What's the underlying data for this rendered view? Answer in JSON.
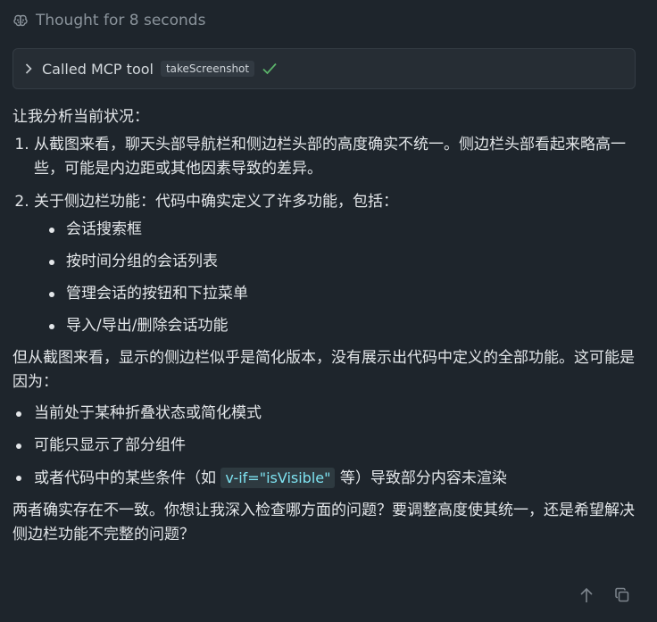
{
  "thought": {
    "label": "Thought for 8 seconds",
    "icon": "brain-icon"
  },
  "tool_call": {
    "label": "Called MCP tool",
    "tool_name": "takeScreenshot",
    "status_icon": "check-icon",
    "status_color": "#5bb36a"
  },
  "message": {
    "intro": "让我分析当前状况：",
    "point1": "从截图来看，聊天头部导航栏和侧边栏头部的高度确实不统一。侧边栏头部看起来略高一些，可能是内边距或其他因素导致的差异。",
    "point2": "关于侧边栏功能：代码中确实定义了许多功能，包括：",
    "features": [
      "会话搜索框",
      "按时间分组的会话列表",
      "管理会话的按钮和下拉菜单",
      "导入/导出/删除会话功能"
    ],
    "para2": "但从截图来看，显示的侧边栏似乎是简化版本，没有展示出代码中定义的全部功能。这可能是因为：",
    "reasons": {
      "r1": "当前处于某种折叠状态或简化模式",
      "r2": "可能只显示了部分组件",
      "r3_prefix": "或者代码中的某些条件（如 ",
      "r3_code": "v-if=\"isVisible\"",
      "r3_suffix": " 等）导致部分内容未渲染"
    },
    "closing": "两者确实存在不一致。你想让我深入检查哪方面的问题？要调整高度使其统一，还是希望解决侧边栏功能不完整的问题？"
  },
  "footer": {
    "icons": [
      "arrow-up-icon",
      "copy-icon"
    ]
  }
}
